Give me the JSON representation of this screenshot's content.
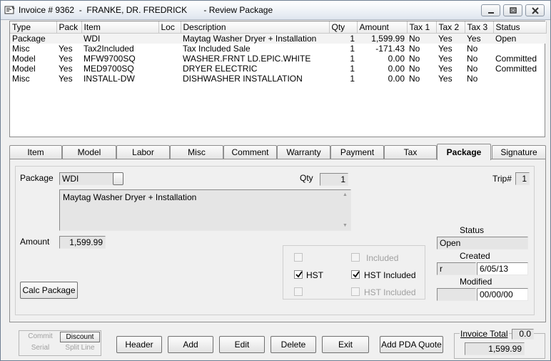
{
  "window": {
    "title": "Invoice # 9362  -  FRANKE, DR. FREDRICK       - Review Package"
  },
  "grid": {
    "columns": [
      "Type",
      "Pack",
      "Item",
      "Loc",
      "Description",
      "Qty",
      "Amount",
      "Tax 1",
      "Tax 2",
      "Tax 3",
      "Status"
    ],
    "rows": [
      [
        "Package",
        "",
        "WDI",
        "",
        "Maytag Washer Dryer + Installation",
        "1",
        "1,599.99",
        "No",
        "Yes",
        "Yes",
        "Open"
      ],
      [
        "Misc",
        "Yes",
        "Tax2Included",
        "",
        "Tax Included Sale",
        "1",
        "-171.43",
        "No",
        "Yes",
        "No",
        ""
      ],
      [
        "Model",
        "Yes",
        "MFW9700SQ",
        "",
        "WASHER.FRNT LD.EPIC.WHITE",
        "1",
        "0.00",
        "No",
        "Yes",
        "No",
        "Committed"
      ],
      [
        "Model",
        "Yes",
        "MED9700SQ",
        "",
        "DRYER ELECTRIC",
        "1",
        "0.00",
        "No",
        "Yes",
        "No",
        "Committed"
      ],
      [
        "Misc",
        "Yes",
        "INSTALL-DW",
        "",
        "DISHWASHER INSTALLATION",
        "1",
        "0.00",
        "No",
        "Yes",
        "No",
        ""
      ]
    ]
  },
  "tabs": [
    {
      "label": "Item"
    },
    {
      "label": "Model"
    },
    {
      "label": "Labor"
    },
    {
      "label": "Misc"
    },
    {
      "label": "Comment"
    },
    {
      "label": "Warranty"
    },
    {
      "label": "Payment"
    },
    {
      "label": "Tax"
    },
    {
      "label": "Package"
    },
    {
      "label": "Signature"
    }
  ],
  "package": {
    "package_label": "Package",
    "package_value": "WDI",
    "qty_label": "Qty",
    "qty_value": "1",
    "trip_label": "Trip#",
    "trip_value": "1",
    "description": "Maytag Washer Dryer + Installation",
    "amount_label": "Amount",
    "amount_value": "1,599.99",
    "calc_button": "Calc Package",
    "status_label": "Status",
    "status_value": "Open",
    "created_label": "Created",
    "created_user": "r",
    "created_date": "6/05/13",
    "modified_label": "Modified",
    "modified_user": "",
    "modified_date": "00/00/00",
    "tax_rows": [
      {
        "left_label": "",
        "left_checked": false,
        "left_enabled": false,
        "right_label": "Included",
        "right_checked": false,
        "right_enabled": false
      },
      {
        "left_label": "HST",
        "left_checked": true,
        "left_enabled": true,
        "right_label": "HST Included",
        "right_checked": true,
        "right_enabled": true
      },
      {
        "left_label": "",
        "left_checked": false,
        "left_enabled": false,
        "right_label": "HST Included",
        "right_checked": false,
        "right_enabled": false
      }
    ]
  },
  "footer": {
    "commit": "Commit",
    "discount": "Discount",
    "serial": "Serial",
    "split_line": "Split Line",
    "header": "Header",
    "add": "Add",
    "edit": "Edit",
    "delete": "Delete",
    "exit": "Exit",
    "add_pda_quote": "Add PDA Quote",
    "invoice_total_label": "Invoice Total",
    "invoice_total_small": "0.0",
    "invoice_total_value": "1,599.99"
  },
  "icons": {
    "app": "invoice-app-icon",
    "minimize": "minimize-icon",
    "maximize": "maximize-icon",
    "close": "close-icon",
    "check": "checkmark-icon"
  }
}
